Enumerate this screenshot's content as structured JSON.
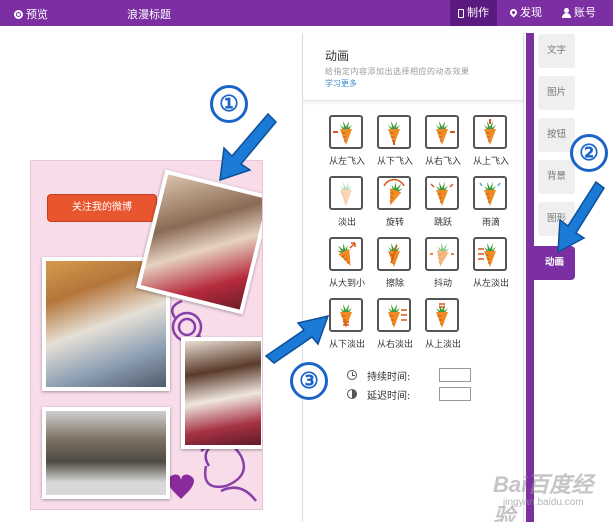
{
  "topbar": {
    "preview_label": "预览",
    "title": "浪漫标题",
    "make_label": "制作",
    "discover_label": "发现",
    "account_label": "账号"
  },
  "card": {
    "follow_button": "关注我的微博"
  },
  "panel": {
    "title": "动画",
    "description": "给指定内容添加出选择相应的动态效果",
    "learn_more": "学习更多",
    "animations": [
      {
        "label": "从左飞入"
      },
      {
        "label": "从下飞入"
      },
      {
        "label": "从右飞入"
      },
      {
        "label": "从上飞入"
      },
      {
        "label": "淡出"
      },
      {
        "label": "旋转"
      },
      {
        "label": "跳跃"
      },
      {
        "label": "雨滴"
      },
      {
        "label": "从大到小"
      },
      {
        "label": "擦除"
      },
      {
        "label": "抖动"
      },
      {
        "label": "从左淡出"
      },
      {
        "label": "从下淡出"
      },
      {
        "label": "从右淡出"
      },
      {
        "label": "从上淡出"
      }
    ],
    "duration_label": "持续时间:",
    "delay_label": "延迟时间:"
  },
  "tabs": [
    {
      "label": "文字"
    },
    {
      "label": "图片"
    },
    {
      "label": "按钮"
    },
    {
      "label": "背景"
    },
    {
      "label": "图形"
    },
    {
      "label": "动画"
    }
  ],
  "badges": [
    "①",
    "②",
    "③"
  ],
  "watermark": {
    "brand": "Bai百度经验",
    "url": "jingyan.baidu.com"
  },
  "colors": {
    "accent": "#7b2fa2",
    "annotation": "#1a64c9",
    "carrot": "#f08a25",
    "leaf": "#3f9a3a"
  }
}
